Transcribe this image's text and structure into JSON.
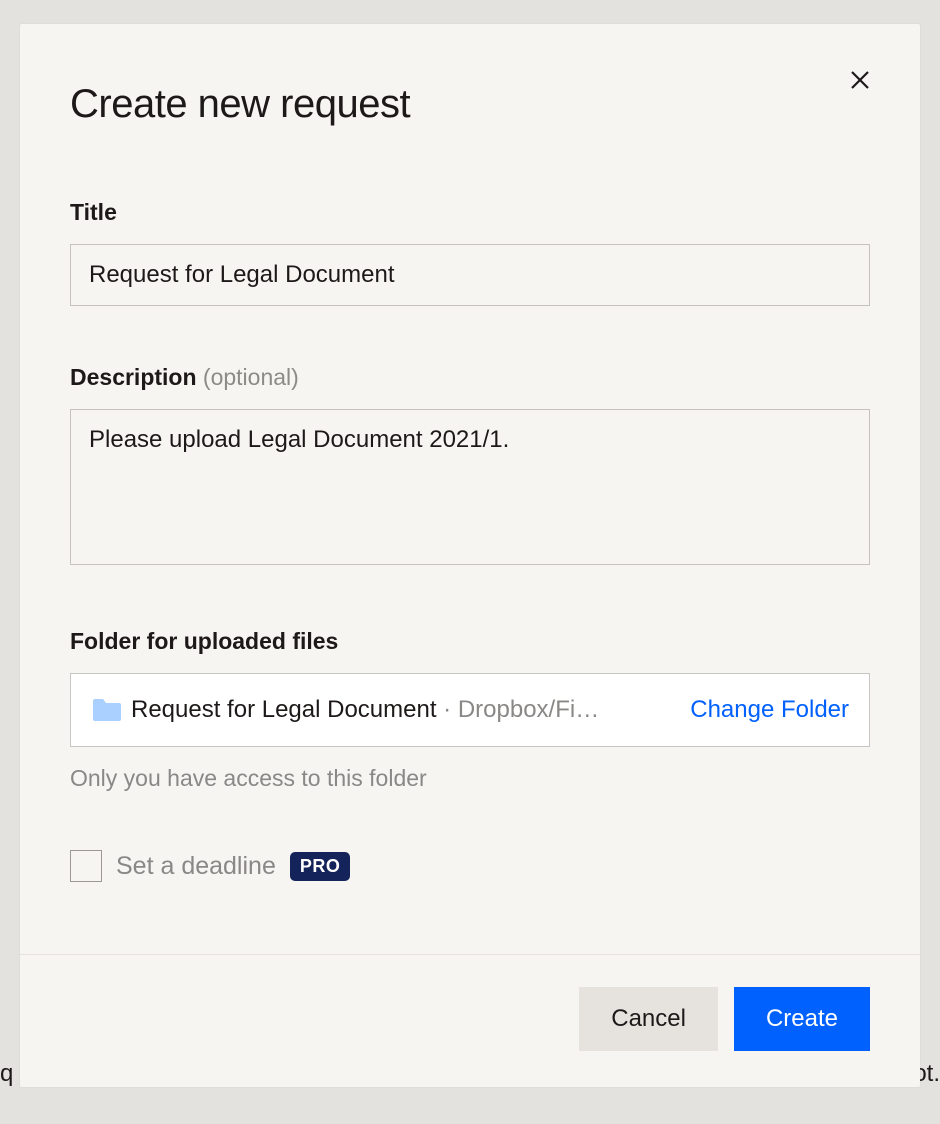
{
  "modal": {
    "title": "Create new request",
    "fields": {
      "title": {
        "label": "Title",
        "value": "Request for Legal Document"
      },
      "description": {
        "label": "Description",
        "optional_suffix": " (optional)",
        "value": "Please upload Legal Document 2021/1."
      },
      "folder": {
        "label": "Folder for uploaded files",
        "folder_name": "Request for Legal Document",
        "path_separator": " · ",
        "path_truncated": "Dropbox/Fi…",
        "change_label": "Change Folder",
        "helper": "Only you have access to this folder"
      },
      "deadline": {
        "label": "Set a deadline",
        "badge": "PRO",
        "checked": false
      }
    },
    "actions": {
      "cancel": "Cancel",
      "create": "Create"
    }
  },
  "background": {
    "left_fragment": "q",
    "right_fragment": "ot."
  },
  "colors": {
    "primary": "#0061fe",
    "badge_bg": "#14235a",
    "modal_bg": "#f7f5f2",
    "page_bg": "#e4e2de"
  }
}
